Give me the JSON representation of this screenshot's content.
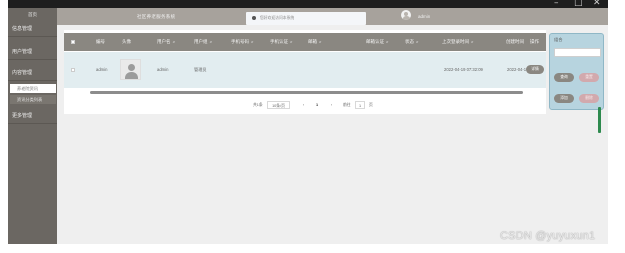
{
  "window": {
    "minimize_glyph": "–",
    "maximize_glyph": "□",
    "close_glyph": "✕"
  },
  "sidebar": {
    "home": "首页",
    "items": [
      {
        "label": "信息管理"
      },
      {
        "label": "用户管理"
      },
      {
        "label": "内容管理",
        "expanded": true
      },
      {
        "label": "更多管理"
      }
    ],
    "subitems": [
      {
        "label": "养老院资讯",
        "active": true
      },
      {
        "label": "资讯分类列表",
        "active": false
      }
    ]
  },
  "header": {
    "title": "社区养老服务系统",
    "notice": "您好欢迎访问本系统",
    "user": "admin"
  },
  "table": {
    "columns": [
      "编号",
      "头像",
      "用户名",
      "用户组",
      "手机号码",
      "手机认证",
      "邮箱",
      "邮箱认证",
      "状态",
      "上次登录时间",
      "创建时间",
      "操作"
    ],
    "rows": [
      {
        "id": "admin",
        "username": "admin",
        "group": "管理员",
        "last_login": "2022-04-19 07:32:09",
        "created": "2022-04-1",
        "action": "详情"
      }
    ]
  },
  "pagination": {
    "total": "共1条",
    "page_size": "10条/页",
    "prev": "‹",
    "current": "1",
    "next": "›",
    "goto_label": "前往",
    "goto_value": "1",
    "page_unit": "页"
  },
  "search_panel": {
    "label": "组合",
    "input_value": "",
    "buttons": [
      "查询",
      "重置",
      "添加",
      "删除"
    ]
  },
  "colors": {
    "sidebar": "#6b6762",
    "topbar": "#a7a29c",
    "table_header": "#8a8781",
    "row_highlight": "#e2edf0",
    "search_panel": "#b7d4df",
    "accent_green": "#2e8a4e"
  },
  "watermark": "CSDN @yuyuxun1"
}
